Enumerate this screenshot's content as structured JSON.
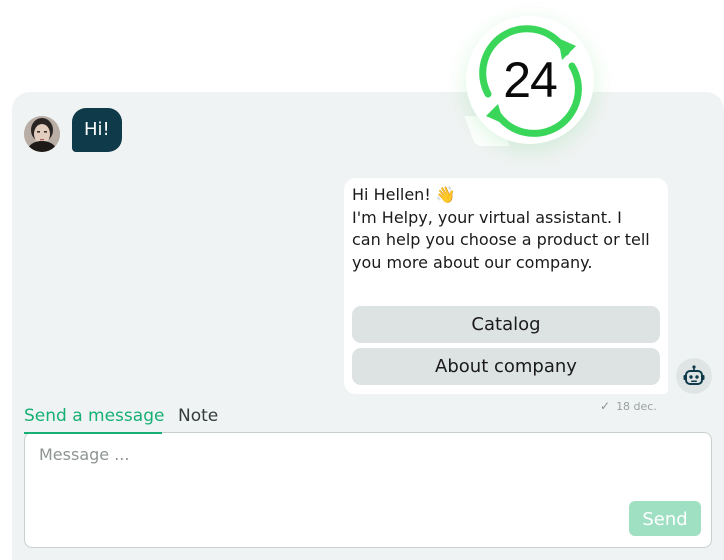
{
  "badge": {
    "text": "24",
    "accent": "#39d65a",
    "icon": "clock-24-icon"
  },
  "user_message": {
    "text": "Hi!",
    "avatar": "user-avatar",
    "bubble_color": "#0f3a4a"
  },
  "bot_message": {
    "greeting": "Hi Hellen! 👋",
    "text": "I'm Helpy, your virtual assistant. I can help you choose a product or tell you more about our company.",
    "quick_replies": [
      "Catalog",
      "About company"
    ],
    "avatar": "robot-icon"
  },
  "status": {
    "check_icon": "check-icon",
    "time": "18 dec."
  },
  "tabs": [
    {
      "label": "Send a message",
      "active": true
    },
    {
      "label": "Note",
      "active": false
    }
  ],
  "composer": {
    "placeholder": "Message ...",
    "value": "",
    "send_label": "Send"
  },
  "colors": {
    "accent": "#16b074",
    "panel": "#f0f3f3",
    "send_disabled": "#9fe0c3"
  }
}
